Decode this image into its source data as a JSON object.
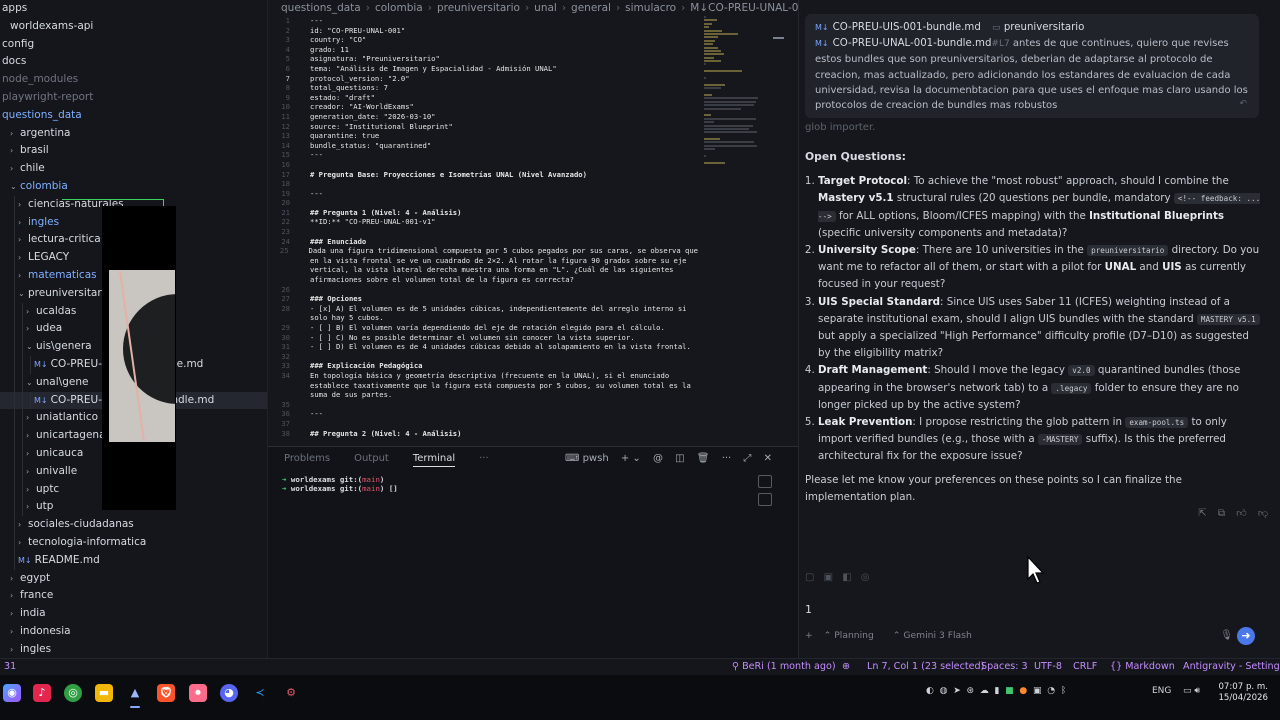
{
  "explorer": {
    "items": [
      {
        "label": "apps",
        "indent": 0,
        "chev": ""
      },
      {
        "label": "worldexams-api",
        "indent": 1,
        "chev": ""
      },
      {
        "label": "config",
        "indent": 0,
        "chev": ""
      },
      {
        "label": "docs",
        "indent": 0,
        "chev": ""
      },
      {
        "label": "node_modules",
        "indent": 0,
        "chev": "",
        "dim": true
      },
      {
        "label": "playwright-report",
        "indent": 0,
        "chev": "",
        "dim": true
      },
      {
        "label": "questions_data",
        "indent": 0,
        "chev": "",
        "accent": true
      },
      {
        "label": "argentina",
        "indent": 1,
        "chev": "›"
      },
      {
        "label": "brasil",
        "indent": 1,
        "chev": "›"
      },
      {
        "label": "chile",
        "indent": 1,
        "chev": "›"
      },
      {
        "label": "colombia",
        "indent": 1,
        "chev": "⌄",
        "accent": true
      },
      {
        "label": "ciencias-naturales",
        "indent": 2,
        "chev": "›"
      },
      {
        "label": "ingles",
        "indent": 2,
        "chev": "›",
        "accent": true
      },
      {
        "label": "lectura-critica",
        "indent": 2,
        "chev": "›"
      },
      {
        "label": "LEGACY",
        "indent": 2,
        "chev": "›"
      },
      {
        "label": "matematicas",
        "indent": 2,
        "chev": "›",
        "accent": true
      },
      {
        "label": "preuniversitario",
        "indent": 2,
        "chev": "⌄"
      },
      {
        "label": "ucaldas",
        "indent": 3,
        "chev": "›"
      },
      {
        "label": "udea",
        "indent": 3,
        "chev": "›"
      },
      {
        "label": "uis\\genera",
        "indent": 3,
        "chev": "⌄"
      },
      {
        "label": "CO-PREU-UIS-001-bundle.md",
        "indent": 4,
        "chev": "",
        "md": true
      },
      {
        "label": "unal\\gene",
        "indent": 3,
        "chev": "⌄"
      },
      {
        "label": "CO-PREU-UNAL-001-bundle.md",
        "indent": 4,
        "chev": "",
        "md": true,
        "selected": true
      },
      {
        "label": "uniatlantico",
        "indent": 3,
        "chev": "›"
      },
      {
        "label": "unicartagena",
        "indent": 3,
        "chev": "›"
      },
      {
        "label": "unicauca",
        "indent": 3,
        "chev": "›"
      },
      {
        "label": "univalle",
        "indent": 3,
        "chev": "›"
      },
      {
        "label": "uptc",
        "indent": 3,
        "chev": "›"
      },
      {
        "label": "utp",
        "indent": 3,
        "chev": "›"
      },
      {
        "label": "sociales-ciudadanas",
        "indent": 2,
        "chev": "›"
      },
      {
        "label": "tecnologia-informatica",
        "indent": 2,
        "chev": "›"
      },
      {
        "label": "README.md",
        "indent": 2,
        "chev": "",
        "md": true
      },
      {
        "label": "egypt",
        "indent": 1,
        "chev": "›"
      },
      {
        "label": "france",
        "indent": 1,
        "chev": "›"
      },
      {
        "label": "india",
        "indent": 1,
        "chev": "›"
      },
      {
        "label": "indonesia",
        "indent": 1,
        "chev": "›"
      },
      {
        "label": "ingles",
        "indent": 1,
        "chev": "›"
      }
    ]
  },
  "editor": {
    "breadcrumb": [
      "questions_data",
      "colombia",
      "preuniversitario",
      "unal",
      "general",
      "simulacro",
      "CO-PREU-UNAL-001-bund"
    ],
    "lines": [
      {
        "n": "1",
        "t": "---",
        "c": "mm"
      },
      {
        "n": "2",
        "t": "id: \"CO-PREU-UNAL-001\"",
        "c": "k"
      },
      {
        "n": "3",
        "t": "country: \"CO\"",
        "c": "k"
      },
      {
        "n": "4",
        "t": "grado: 11",
        "c": "k"
      },
      {
        "n": "5",
        "t": "asignatura: \"Preuniversitario\"",
        "c": "k"
      },
      {
        "n": "6",
        "t": "tema: \"Análisis de Imagen y Espacialidad - Admisión UNAL\"",
        "c": "k"
      },
      {
        "n": "7",
        "t": "protocol_version: \"2.0\"",
        "c": "k",
        "cur": true
      },
      {
        "n": "8",
        "t": "total_questions: 7",
        "c": "k"
      },
      {
        "n": "9",
        "t": "estado: \"draft\"",
        "c": "k"
      },
      {
        "n": "10",
        "t": "creador: \"AI-WorldExams\"",
        "c": "k"
      },
      {
        "n": "11",
        "t": "generation_date: \"2026-03-10\"",
        "c": "k"
      },
      {
        "n": "12",
        "t": "source: \"Institutional Blueprint\"",
        "c": "k"
      },
      {
        "n": "13",
        "t": "quarantine: true",
        "c": "k"
      },
      {
        "n": "14",
        "t": "bundle_status: \"quarantined\"",
        "c": "k"
      },
      {
        "n": "15",
        "t": "---",
        "c": "mm"
      },
      {
        "n": "16",
        "t": "",
        "c": ""
      },
      {
        "n": "17",
        "t": "# Pregunta Base: Proyecciones e Isometrías UNAL (Nivel Avanzado)",
        "c": "h"
      },
      {
        "n": "18",
        "t": "",
        "c": ""
      },
      {
        "n": "19",
        "t": "---",
        "c": "mm"
      },
      {
        "n": "20",
        "t": "",
        "c": ""
      },
      {
        "n": "21",
        "t": "## Pregunta 1 (Nivel: 4 - Análisis)",
        "c": "h"
      },
      {
        "n": "22",
        "t": "**ID:** \"CO-PREU-UNAL-001-v1\"",
        "c": "tx"
      },
      {
        "n": "23",
        "t": "",
        "c": ""
      },
      {
        "n": "24",
        "t": "### Enunciado",
        "c": "h"
      },
      {
        "n": "25",
        "t": "Dada una figura tridimensional compuesta por 5 cubos pegados por sus caras, se observa que",
        "c": "tx"
      },
      {
        "n": "",
        "t": "en la vista frontal se ve un cuadrado de 2×2. Al rotar la figura 90 grados sobre su eje",
        "c": "tx"
      },
      {
        "n": "",
        "t": "vertical, la vista lateral derecha muestra una forma en \"L\". ¿Cuál de las siguientes",
        "c": "tx"
      },
      {
        "n": "",
        "t": "afirmaciones sobre el volumen total de la figura es correcta?",
        "c": "tx"
      },
      {
        "n": "26",
        "t": "",
        "c": ""
      },
      {
        "n": "27",
        "t": "### Opciones",
        "c": "h"
      },
      {
        "n": "28",
        "t": "- [x] A) El volumen es de 5 unidades cúbicas, independientemente del arreglo interno si",
        "c": "tx"
      },
      {
        "n": "",
        "t": "solo hay 5 cubos.",
        "c": "tx"
      },
      {
        "n": "29",
        "t": "- [ ] B) El volumen varía dependiendo del eje de rotación elegido para el cálculo.",
        "c": "tx"
      },
      {
        "n": "30",
        "t": "- [ ] C) No es posible determinar el volumen sin conocer la vista superior.",
        "c": "tx"
      },
      {
        "n": "31",
        "t": "- [ ] D) El volumen es de 4 unidades cúbicas debido al solapamiento en la vista frontal.",
        "c": "tx"
      },
      {
        "n": "32",
        "t": "",
        "c": ""
      },
      {
        "n": "33",
        "t": "### Explicación Pedagógica",
        "c": "h"
      },
      {
        "n": "34",
        "t": "En topología básica y geometría descriptiva (frecuente en la UNAL), si el enunciado",
        "c": "tx"
      },
      {
        "n": "",
        "t": "establece taxativamente que la figura está compuesta por 5 cubos, su volumen total es la",
        "c": "tx"
      },
      {
        "n": "",
        "t": "suma de sus partes.",
        "c": "tx"
      },
      {
        "n": "35",
        "t": "",
        "c": ""
      },
      {
        "n": "36",
        "t": "---",
        "c": "mm"
      },
      {
        "n": "37",
        "t": "",
        "c": ""
      },
      {
        "n": "38",
        "t": "## Pregunta 2 (Nivel: 4 - Análisis)",
        "c": "h"
      }
    ]
  },
  "panel": {
    "tabs": [
      "Problems",
      "Output",
      "Terminal",
      "···"
    ],
    "active_tab": "Terminal",
    "shell": "pwsh",
    "terminal_lines": [
      {
        "arrow": "➜",
        "path": "worldexams",
        "git": "git:(",
        "branch": "main",
        "close": ")"
      },
      {
        "arrow": "➜",
        "path": "worldexams",
        "git": "git:(",
        "branch": "main",
        "close": ") []"
      }
    ]
  },
  "chat": {
    "context_files": [
      {
        "name": "CO-PREU-UIS-001-bundle.md",
        "extra": "preuniversitario"
      },
      {
        "name": "CO-PREU-UNAL-001-bundle.md",
        "extra": "#L7"
      }
    ],
    "user_message": "antes de que continues, quiero que revises estos bundles que son preuniversitarios, deberian de adaptarse al protocolo de creacion, mas actualizado, pero adicionando los estandares de evaluacion de cada universidad, revisa la documenbtacion para que uses el enfoque mas claro usando los protocolos de creacion de bundles mas robustos",
    "faded_text": "glob importer.",
    "heading": "Open Questions:",
    "questions": [
      {
        "title": "Target Protocol",
        "parts": [
          ": To achieve the \"most robust\" approach, should I combine the ",
          "b:Mastery v5.1",
          " structural rules (20 questions per bundle, mandatory ",
          "c:<!-- feedback: ... -->",
          " for ALL options, Bloom/ICFES mapping) with the ",
          "b:Institutional Blueprints",
          " (specific university components and metadata)?"
        ]
      },
      {
        "title": "University Scope",
        "parts": [
          ": There are 10 universities in the ",
          "c:preuniversitario",
          " directory. Do you want me to refactor all of them, or start with a pilot for ",
          "b:UNAL",
          " and ",
          "b:UIS",
          " as currently focused in your request?"
        ]
      },
      {
        "title": "UIS Special Standard",
        "parts": [
          ": Since UIS uses Saber 11 (ICFES) weighting instead of a separate institutional exam, should I align UIS bundles with the standard ",
          "c:MASTERY v5.1",
          " but apply a specialized \"High Performance\" difficulty profile (D7–D10) as suggested by the eligibility matrix?"
        ]
      },
      {
        "title": "Draft Management",
        "parts": [
          ": Should I move the legacy ",
          "c:v2.0",
          " quarantined bundles (those appearing in the browser's network tab) to a ",
          "c:.legacy",
          " folder to ensure they are no longer picked up by the active system?"
        ]
      },
      {
        "title": "Leak Prevention",
        "parts": [
          ": I propose restricting the glob pattern in ",
          "c:exam-pool.ts",
          " to only import verified bundles (e.g., those with a ",
          "c:-MASTERY",
          " suffix). Is this the preferred architectural fix for the exposure issue?"
        ]
      }
    ],
    "closing": "Please let me know your preferences on these points so I can finalize the implementation plan.",
    "input_value": "1",
    "mode": "Planning",
    "model": "Gemini 3 Flash"
  },
  "statusbar": {
    "left": "31",
    "blame": "BeRi (1 month ago)",
    "position": "Ln 7, Col 1 (23 selected)",
    "spaces": "Spaces: 3",
    "encoding": "UTF-8",
    "eol": "CRLF",
    "language": "Markdown",
    "app": "Antigravity - Settings"
  },
  "taskbar": {
    "lang": "ENG",
    "time": "07:07 p. m.",
    "date": "15/04/2026"
  }
}
